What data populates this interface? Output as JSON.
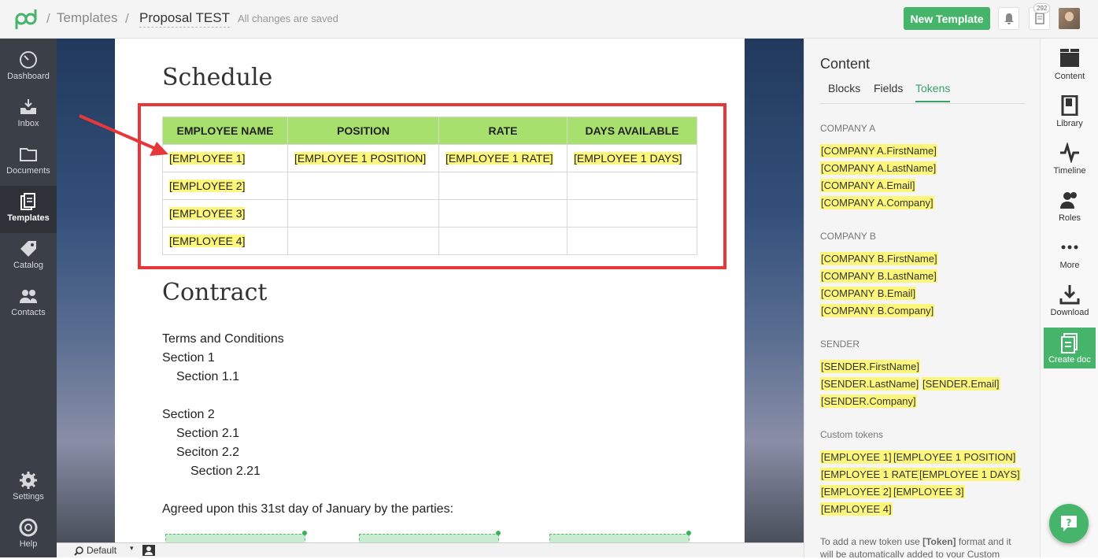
{
  "topbar": {
    "breadcrumb_parent": "Templates",
    "doc_title": "Proposal TEST",
    "save_status": "All changes are saved",
    "new_template_label": "New Template",
    "docs_badge": "292"
  },
  "leftnav": [
    {
      "label": "Dashboard",
      "icon": "dashboard-icon"
    },
    {
      "label": "Inbox",
      "icon": "inbox-icon"
    },
    {
      "label": "Documents",
      "icon": "folder-icon"
    },
    {
      "label": "Templates",
      "icon": "templates-icon",
      "active": true
    },
    {
      "label": "Catalog",
      "icon": "tag-icon"
    },
    {
      "label": "Contacts",
      "icon": "contacts-icon"
    },
    {
      "label": "Settings",
      "icon": "gear-icon"
    },
    {
      "label": "Help",
      "icon": "lifebuoy-icon"
    }
  ],
  "document": {
    "schedule_heading": "Schedule",
    "table_headers": [
      "EMPLOYEE NAME",
      "POSITION",
      "RATE",
      "DAYS AVAILABLE"
    ],
    "table_rows": [
      [
        "[EMPLOYEE 1]",
        "[EMPLOYEE 1 POSITION]",
        "[EMPLOYEE 1 RATE]",
        "[EMPLOYEE 1 DAYS]"
      ],
      [
        "[EMPLOYEE 2]",
        "",
        "",
        ""
      ],
      [
        "[EMPLOYEE 3]",
        "",
        "",
        ""
      ],
      [
        "[EMPLOYEE 4]",
        "",
        "",
        ""
      ]
    ],
    "contract_heading": "Contract",
    "terms": "Terms and Conditions",
    "section1": "Section 1",
    "section1_1": "Section 1.1",
    "section2": "Section 2",
    "section2_1": "Section 2.1",
    "section2_2": "Seciton 2.2",
    "section2_21": "Section 2.21",
    "agreement": "Agreed upon this 31st day of January by the parties:"
  },
  "bottombar": {
    "zoom_label": "Default"
  },
  "panel": {
    "title": "Content",
    "tabs": [
      "Blocks",
      "Fields",
      "Tokens"
    ],
    "active_tab": "Tokens",
    "company_a_label": "COMPANY A",
    "company_a_tokens": [
      "[COMPANY A.FirstName]",
      "[COMPANY A.LastName]",
      "[COMPANY A.Email]",
      "[COMPANY A.Company]"
    ],
    "company_b_label": "COMPANY B",
    "company_b_tokens": [
      "[COMPANY B.FirstName]",
      "[COMPANY B.LastName]",
      "[COMPANY B.Email]",
      "[COMPANY B.Company]"
    ],
    "sender_label": "SENDER",
    "sender_tokens": [
      "[SENDER.FirstName]",
      "[SENDER.LastName]",
      "[SENDER.Email]",
      "[SENDER.Company]"
    ],
    "custom_label": "Custom tokens",
    "custom_tokens": [
      "[EMPLOYEE 1]",
      "[EMPLOYEE 1 POSITION]",
      "[EMPLOYEE 1 RATE]",
      "[EMPLOYEE 1 DAYS]",
      "[EMPLOYEE 2]",
      "[EMPLOYEE 3]",
      "[EMPLOYEE 4]"
    ],
    "help_prefix": "To add a new token use ",
    "help_token": "[Token]",
    "help_suffix": " format and it will be automatically added to your Custom"
  },
  "rail": [
    {
      "label": "Content",
      "icon": "content-icon"
    },
    {
      "label": "Library",
      "icon": "library-icon"
    },
    {
      "label": "Timeline",
      "icon": "timeline-icon"
    },
    {
      "label": "Roles",
      "icon": "roles-icon"
    },
    {
      "label": "More",
      "icon": "more-icon"
    },
    {
      "label": "Download",
      "icon": "download-icon"
    },
    {
      "label": "Create doc",
      "icon": "create-doc-icon"
    }
  ],
  "colors": {
    "brand_green": "#47b46b",
    "token_yellow": "#fcf67a",
    "table_header_green": "#a8e06e",
    "highlight_red": "#e8373a"
  }
}
